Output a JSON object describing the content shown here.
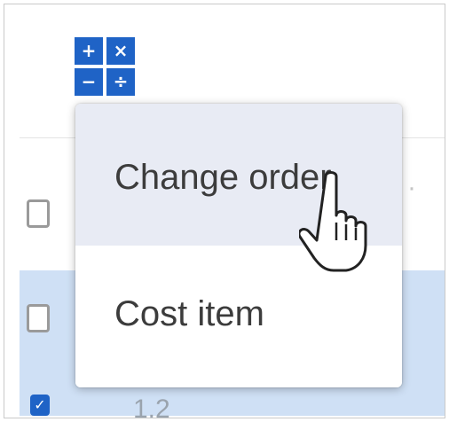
{
  "toolbar": {
    "calculator_icon": {
      "icon": "calculator-icon",
      "symbols": [
        "+",
        "×",
        "−",
        "÷"
      ],
      "color": "#1f63c6"
    }
  },
  "background_table": {
    "highlight_color": "#cfe0f5",
    "visible_row_number": "1.2"
  },
  "menu": {
    "items": [
      {
        "label": "Change order",
        "hovered": true
      },
      {
        "label": "Cost item",
        "hovered": false
      }
    ],
    "hover_color": "#e8ebf4"
  },
  "cursor": {
    "icon": "hand-pointer-icon"
  }
}
